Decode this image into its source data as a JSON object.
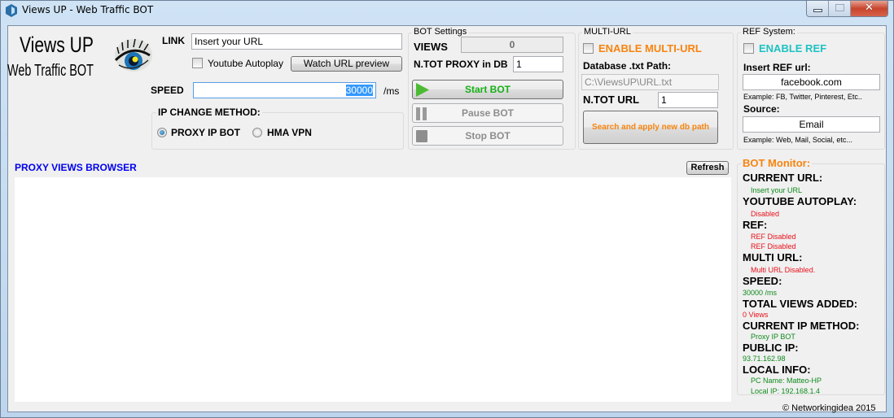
{
  "window": {
    "title": "Views UP - Web Traffic BOT",
    "icon": "app-hexagon-icon",
    "controls": [
      "minimize",
      "maximize",
      "close"
    ]
  },
  "logo": {
    "title": "Views UP",
    "subtitle": "Web Traffic BOT",
    "image": "eye-icon"
  },
  "link_section": {
    "link_label": "LINK",
    "link_value": "Insert your URL",
    "youtube_autoplay_label": "Youtube Autoplay",
    "youtube_autoplay_checked": false,
    "watch_preview_label": "Watch URL preview",
    "speed_label": "SPEED",
    "speed_value": "30000",
    "speed_unit": "/ms"
  },
  "ip_change": {
    "legend": "IP CHANGE METHOD:",
    "options": [
      {
        "label": "PROXY IP BOT",
        "selected": true
      },
      {
        "label": "HMA VPN",
        "selected": false
      }
    ]
  },
  "bot_settings": {
    "legend": "BOT Settings",
    "views_label": "VIEWS",
    "views_value": "0",
    "proxy_label": "N.TOT PROXY in DB",
    "proxy_value": "1",
    "start_label": "Start BOT",
    "pause_label": "Pause BOT",
    "stop_label": "Stop BOT"
  },
  "multi_url": {
    "legend": "MULTI-URL",
    "enable_label": "ENABLE MULTI-URL",
    "enable_checked": false,
    "db_path_label": "Database .txt Path:",
    "db_path_value": "C:\\ViewsUP\\URL.txt",
    "ntot_url_label": "N.TOT URL",
    "ntot_url_value": "1",
    "search_button_label": "Search and apply new db path"
  },
  "ref_system": {
    "legend": "REF System:",
    "enable_label": "ENABLE REF",
    "enable_checked": false,
    "ref_url_label": "Insert REF url:",
    "ref_url_value": "facebook.com",
    "ref_example": "Example: FB, Twitter, Pinterest, Etc..",
    "source_label": "Source:",
    "source_value": "Email",
    "source_example": "Example: Web, Mail, Social, etc..."
  },
  "browser": {
    "title": "PROXY VIEWS BROWSER",
    "refresh_label": "Refresh"
  },
  "monitor": {
    "legend": "BOT Monitor:",
    "entries": [
      {
        "label": "CURRENT URL:",
        "values": [
          "Insert your URL"
        ],
        "status": "green"
      },
      {
        "label": "YOUTUBE AUTOPLAY:",
        "values": [
          "Disabled"
        ],
        "status": "red"
      },
      {
        "label": "REF:",
        "values": [
          "REF Disabled",
          "REF Disabled"
        ],
        "status": "red"
      },
      {
        "label": "MULTI URL:",
        "values": [
          "Multi URL Disabled."
        ],
        "status": "red"
      },
      {
        "label": "SPEED:",
        "values": [
          "30000 /ms"
        ],
        "status": "green"
      },
      {
        "label": "TOTAL VIEWS ADDED:",
        "values": [
          "0 Views"
        ],
        "status": "red"
      },
      {
        "label": "CURRENT IP METHOD:",
        "values": [
          "Proxy IP BOT"
        ],
        "status": "green"
      },
      {
        "label": "PUBLIC IP:",
        "values": [
          "93.71.162.98"
        ],
        "status": "green"
      },
      {
        "label": "LOCAL INFO:",
        "values": [
          "PC Name: Matteo-HP",
          "Local IP: 192.168.1.4"
        ],
        "status": "green"
      }
    ]
  },
  "footer": {
    "copyright": "© Networkingidea 2015"
  },
  "colors": {
    "start_green": "#17b017",
    "multi_orange": "#f7840f",
    "ref_teal": "#1ec2c2",
    "browser_blue": "#0000ee",
    "monitor_orange": "#f7840f",
    "ok_green": "#0d8a1b",
    "warn_red": "#e8101a"
  }
}
